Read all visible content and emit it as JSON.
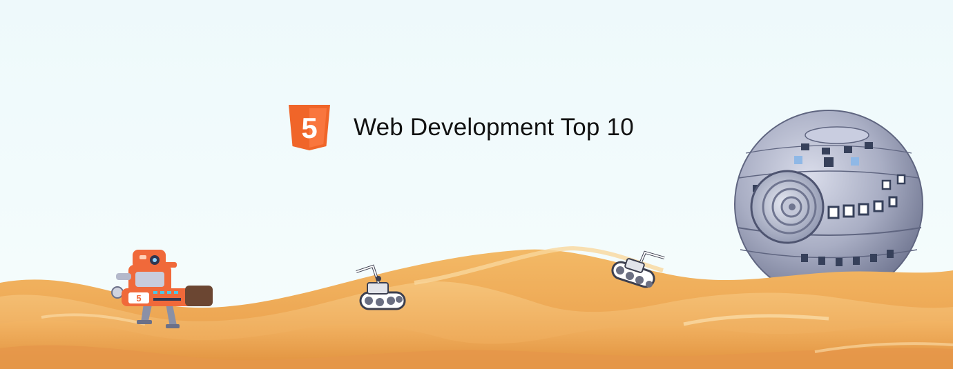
{
  "banner": {
    "title": "Web Development Top 10",
    "logo_number": "5",
    "logo_icon": "html5-shield-icon",
    "robot_badge": "5"
  },
  "colors": {
    "sky": "#f1fbfc",
    "sand_light": "#f7c77a",
    "sand_mid": "#eea650",
    "sand_dark": "#d98a35",
    "html5_orange": "#f06529",
    "html5_orange_light": "#f9763e",
    "robot_orange": "#f0693a",
    "sphere_gray": "#a6acc0",
    "text": "#111111"
  }
}
